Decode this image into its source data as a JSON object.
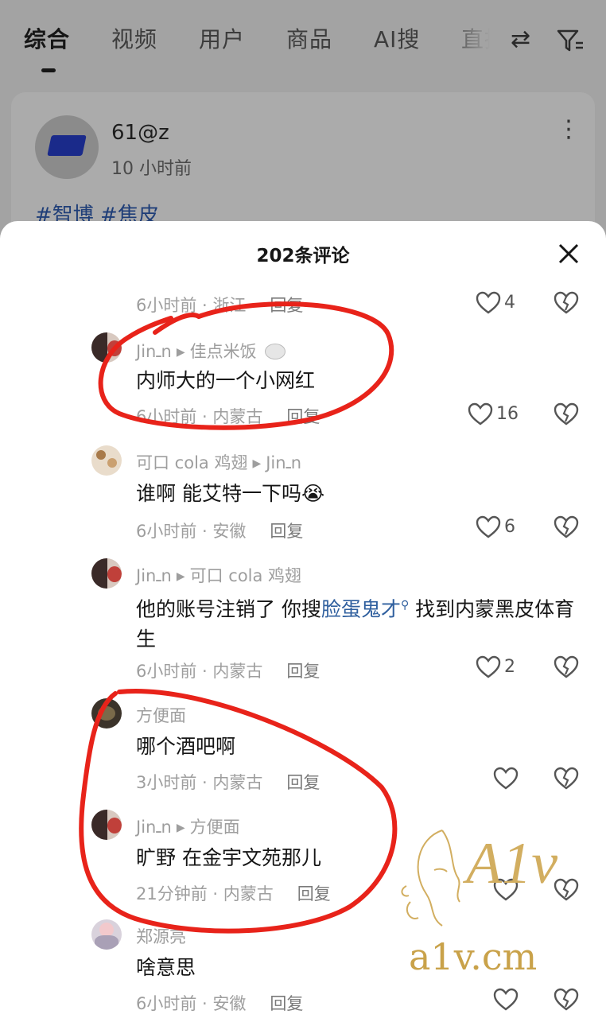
{
  "tabs": [
    {
      "label": "综合",
      "active": true
    },
    {
      "label": "视频"
    },
    {
      "label": "用户"
    },
    {
      "label": "商品"
    },
    {
      "label": "AI搜"
    },
    {
      "label": "直播"
    }
  ],
  "header_icons": [
    "swap-icon",
    "filter-icon"
  ],
  "post": {
    "author": "61@z",
    "time": "10 小时前",
    "tags": "#智博 #焦皮"
  },
  "sheet": {
    "title": "202条评论"
  },
  "comments": [
    {
      "meta": "",
      "text": "",
      "time": "6小时前 · 浙江",
      "reply": "回复",
      "likes": "4"
    },
    {
      "user": "Jinـn",
      "reply_to": "佳点米饭",
      "text": "内师大的一个小网红",
      "time": "6小时前 · 内蒙古",
      "reply": "回复",
      "likes": "16"
    },
    {
      "user": "可口 cola 鸡翅",
      "reply_to": "Jinـn",
      "text": "谁啊 能艾特一下吗😭",
      "time": "6小时前 · 安徽",
      "reply": "回复",
      "likes": "6"
    },
    {
      "user": "Jinـn",
      "reply_to": "可口 cola 鸡翅",
      "text_before": "他的账号注销了 你搜",
      "text_link": "脸蛋鬼才",
      "text_after": " 找到内蒙黑皮体育生",
      "time": "6小时前 · 内蒙古",
      "reply": "回复",
      "likes": "2"
    },
    {
      "user": "方便面",
      "text": "哪个酒吧啊",
      "time": "3小时前 · 内蒙古",
      "reply": "回复",
      "likes": ""
    },
    {
      "user": "Jinـn",
      "reply_to": "方便面",
      "text": "旷野 在金宇文苑那儿",
      "time": "21分钟前 · 内蒙古",
      "reply": "回复",
      "likes": ""
    },
    {
      "user": "郑源亮",
      "text": "啥意思",
      "time": "6小时前 · 安徽",
      "reply": "回复",
      "likes": ""
    }
  ],
  "watermark": {
    "logo_text": "A1v",
    "site": "a1v.cm"
  },
  "colors": {
    "annotation_red": "#e8231a",
    "link_blue": "#2f5f9e",
    "watermark_gold": "#c9a24a"
  }
}
